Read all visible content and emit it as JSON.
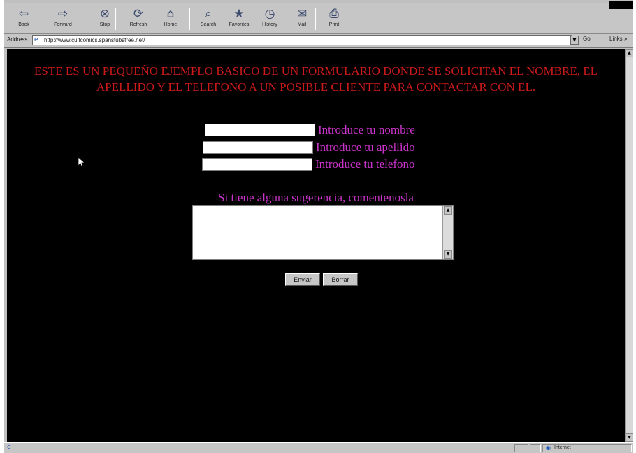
{
  "toolbar": {
    "buttons": [
      {
        "label": "Back",
        "icon": "back-arrow-icon",
        "glyph": "⇦"
      },
      {
        "label": "Forward",
        "icon": "forward-arrow-icon",
        "glyph": "⇨"
      },
      {
        "label": "Stop",
        "icon": "stop-icon",
        "glyph": "⊗"
      },
      {
        "label": "Refresh",
        "icon": "refresh-icon",
        "glyph": "⟳"
      },
      {
        "label": "Home",
        "icon": "home-icon",
        "glyph": "⌂"
      },
      {
        "label": "Search",
        "icon": "search-icon",
        "glyph": "⌕"
      },
      {
        "label": "Favorites",
        "icon": "favorites-icon",
        "glyph": "★"
      },
      {
        "label": "History",
        "icon": "history-icon",
        "glyph": "◷"
      },
      {
        "label": "Mail",
        "icon": "mail-icon",
        "glyph": "✉"
      },
      {
        "label": "Print",
        "icon": "print-icon",
        "glyph": "⎙"
      }
    ]
  },
  "address_bar": {
    "label": "Address",
    "url": "http://www.cultcomics.spanstubsfree.net/",
    "go_label": "Go",
    "links_label": "Links »"
  },
  "page": {
    "intro": "ESTE ES UN PEQUEÑO EJEMPLO BASICO DE UN FORMULARIO DONDE SE SOLICITAN EL NOMBRE, EL APELLIDO Y EL TELEFONO A UN POSIBLE CLIENTE PARA CONTACTAR CON EL.",
    "fields": {
      "nombre_label": "Introduce tu nombre",
      "nombre_value": "",
      "apellido_label": "Introduce tu apellido",
      "apellido_value": "",
      "telefono_label": "Introduce tu telefono",
      "telefono_value": ""
    },
    "suggestion_label": "Si tiene alguna sugerencia, comentenosla",
    "suggestion_value": "",
    "enviar_label": "Enviar",
    "borrar_label": "Borrar"
  },
  "status_bar": {
    "zone_label": "Internet"
  },
  "colors": {
    "page_background": "#000000",
    "intro_text": "#cc1a1a",
    "label_text": "#cc33cc",
    "chrome": "#c6c6c6"
  }
}
